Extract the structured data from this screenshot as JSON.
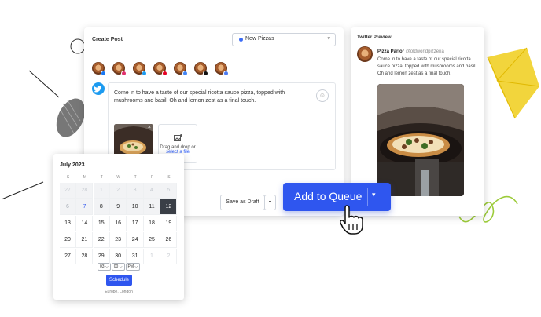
{
  "composer": {
    "title": "Create Post",
    "group_select": "New Pizzas",
    "caret": "▾",
    "post_text": "Come in to have a taste of our special ricotta sauce pizza, topped with mushrooms and basil. Oh and lemon zest as a final touch.",
    "emoji": "☺",
    "thumb_close": "×",
    "dropzone_icon": "image-add-icon",
    "dropzone_text": "Drag and drop or",
    "dropzone_link": "select a file",
    "save_draft": "Save as Draft",
    "draft_caret": "▾"
  },
  "channels": [
    {
      "network": "facebook",
      "color": "#1877f2"
    },
    {
      "network": "instagram",
      "color": "#e1306c"
    },
    {
      "network": "twitter",
      "color": "#1d9bf0"
    },
    {
      "network": "pinterest",
      "color": "#e60023"
    },
    {
      "network": "google-business",
      "color": "#4285f4"
    },
    {
      "network": "tiktok",
      "color": "#111111"
    },
    {
      "network": "facebook-group",
      "color": "#4c7cf3"
    }
  ],
  "twitter_badge": "🐦",
  "preview": {
    "title": "Twitter Preview",
    "name": "Pizza Parlor",
    "handle": "@oldworldpizzeria",
    "text": "Come in to have a taste of our special ricotta sauce pizza, topped with mushrooms and basil. Oh and lemon zest as a final touch."
  },
  "queue": {
    "label": "Add to Queue",
    "caret": "▾"
  },
  "calendar": {
    "month": "July 2023",
    "weekdays": [
      "S",
      "M",
      "T",
      "W",
      "T",
      "F",
      "S"
    ],
    "weeks": [
      [
        {
          "d": "27",
          "s": "muted"
        },
        {
          "d": "28",
          "s": "muted"
        },
        {
          "d": "1",
          "s": "muted"
        },
        {
          "d": "2",
          "s": "muted"
        },
        {
          "d": "3",
          "s": "muted"
        },
        {
          "d": "4",
          "s": "muted"
        },
        {
          "d": "5",
          "s": "muted"
        }
      ],
      [
        {
          "d": "6",
          "s": "dim"
        },
        {
          "d": "7",
          "s": "today"
        },
        {
          "d": "8",
          "s": ""
        },
        {
          "d": "9",
          "s": ""
        },
        {
          "d": "10",
          "s": ""
        },
        {
          "d": "11",
          "s": ""
        },
        {
          "d": "12",
          "s": "sel"
        }
      ],
      [
        {
          "d": "13",
          "s": ""
        },
        {
          "d": "14",
          "s": ""
        },
        {
          "d": "15",
          "s": ""
        },
        {
          "d": "16",
          "s": ""
        },
        {
          "d": "17",
          "s": ""
        },
        {
          "d": "18",
          "s": ""
        },
        {
          "d": "19",
          "s": ""
        }
      ],
      [
        {
          "d": "20",
          "s": ""
        },
        {
          "d": "21",
          "s": ""
        },
        {
          "d": "22",
          "s": ""
        },
        {
          "d": "23",
          "s": ""
        },
        {
          "d": "24",
          "s": ""
        },
        {
          "d": "25",
          "s": ""
        },
        {
          "d": "26",
          "s": ""
        }
      ],
      [
        {
          "d": "27",
          "s": ""
        },
        {
          "d": "28",
          "s": ""
        },
        {
          "d": "29",
          "s": ""
        },
        {
          "d": "30",
          "s": ""
        },
        {
          "d": "31",
          "s": ""
        },
        {
          "d": "1",
          "s": "muted"
        },
        {
          "d": "2",
          "s": "muted"
        }
      ]
    ],
    "hour": "03",
    "minute": "00",
    "meridiem": "PM",
    "time_caret": "⌵",
    "schedule": "Schedule",
    "timezone": "Europe, London"
  },
  "cursor": "pointing-hand-cursor-icon"
}
